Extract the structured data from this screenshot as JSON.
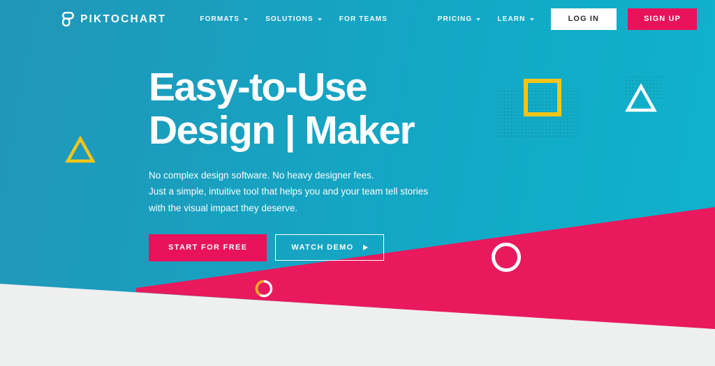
{
  "brand": {
    "name": "PIKTOCHART",
    "logo_icon": "piktochart-p-mark-icon",
    "accent_pink": "#e8125a",
    "accent_yellow": "#f5c518",
    "bg_teal_left": "#2196b8",
    "bg_teal_right": "#0fb3cc",
    "bg_gray": "#eeefef"
  },
  "header": {
    "nav_left": [
      {
        "label": "FORMATS",
        "has_dropdown": true
      },
      {
        "label": "SOLUTIONS",
        "has_dropdown": true
      },
      {
        "label": "FOR TEAMS",
        "has_dropdown": false
      }
    ],
    "nav_right": [
      {
        "label": "PRICING",
        "has_dropdown": true
      },
      {
        "label": "LEARN",
        "has_dropdown": true
      }
    ],
    "login_label": "LOG IN",
    "signup_label": "SIGN UP"
  },
  "hero": {
    "headline_line1": "Easy-to-Use",
    "headline_line2": "Design | Maker",
    "subcopy_line1": "No complex design software. No heavy designer fees.",
    "subcopy_line2": "Just a simple, intuitive tool that helps you and your team tell stories",
    "subcopy_line3": "with the visual impact they deserve.",
    "cta_primary": "START FOR FREE",
    "cta_secondary": "WATCH DEMO",
    "cta_secondary_icon": "play-triangle-icon"
  },
  "decor": {
    "square_outline_color": "#f5c518",
    "triangle_white_color": "#ffffff",
    "triangle_yellow_color": "#f5c518",
    "circle_large_color": "#ffffff",
    "circle_small_arc_color": "#f5a623",
    "dot_pattern_color": "#1a7fa0"
  }
}
